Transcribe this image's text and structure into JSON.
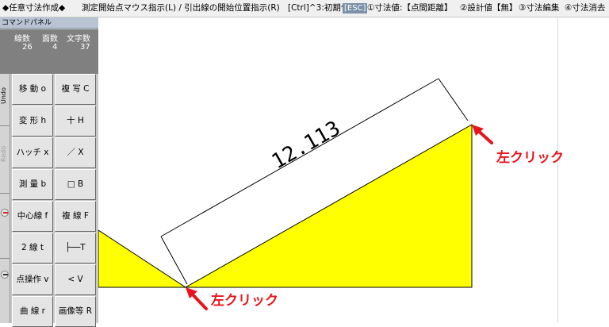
{
  "status_bar": {
    "mode": "◆任意寸法作成◆",
    "instruction": "測定開始点マウス指示(L) / 引出線の開始位置指示(R)",
    "ctrl_hint": "[Ctrl]^3:初期化",
    "esc": "[ESC]",
    "option1": "①寸法値:【点間距離】",
    "option2": "②設計値【無】",
    "option3": "③寸法編集",
    "option4": "④寸法消去"
  },
  "command_panel": {
    "title": "コマンドパネル",
    "counters": {
      "labels": [
        "線数",
        "面数",
        "文字数"
      ],
      "values": [
        "26",
        "4",
        "37"
      ]
    },
    "side": {
      "undo": "Undo",
      "redo": "Redo"
    },
    "buttons": [
      {
        "left": "移 動 o",
        "right": "複 写 C"
      },
      {
        "left": "変 形 h",
        "right": "十  H"
      },
      {
        "left": "ハッチ x",
        "right": "／  X"
      },
      {
        "left": "測 量 b",
        "right": "□  B"
      },
      {
        "left": "中心線 f",
        "right": "複 線 F"
      },
      {
        "left": "2 線 t",
        "right": "├──T"
      },
      {
        "left": "点操作 v",
        "right": "<  V"
      },
      {
        "left": "曲 線 r",
        "right": "画像等 R"
      }
    ]
  },
  "drawing": {
    "dimension_value": "12.113",
    "fill_color": "#ffff00"
  },
  "annotations": {
    "click_top": "左クリック",
    "click_bottom": "左クリック",
    "color": "#e8141c"
  }
}
